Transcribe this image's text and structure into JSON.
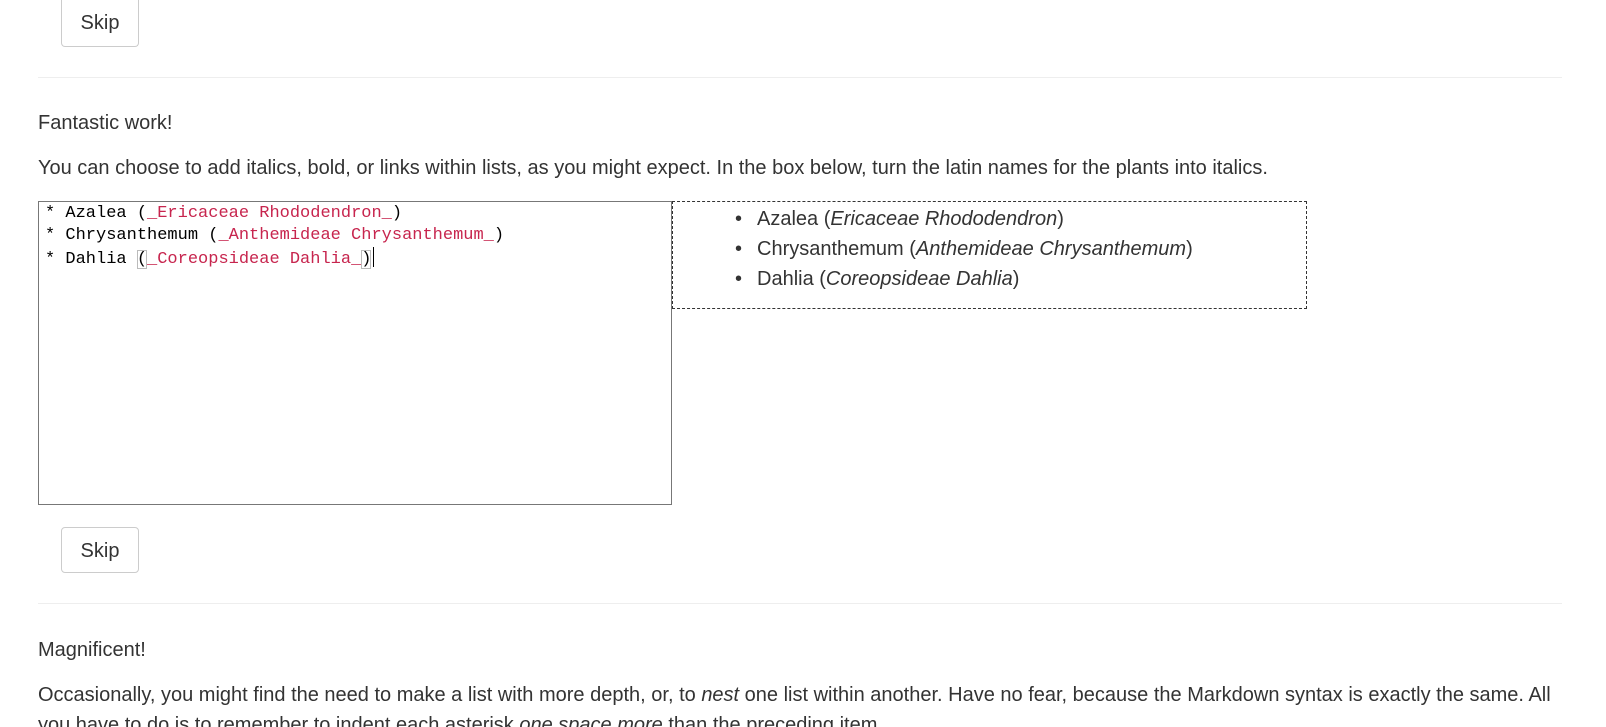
{
  "skip_button_label": "Skip",
  "section_2": {
    "heading": "Fantastic work!",
    "instructions": "You can choose to add italics, bold, or links within lists, as you might expect. In the box below, turn the latin names for the plants into italics.",
    "editor_lines": [
      {
        "prefix": "* Azalea (",
        "emphasis": "_Ericaceae Rhododendron_",
        "suffix": ")"
      },
      {
        "prefix": "* Chrysanthemum (",
        "emphasis": "_Anthemideae Chrysanthemum_",
        "suffix": ")"
      },
      {
        "prefix": "* Dahlia ",
        "open_bracket": "(",
        "emphasis": "_Coreopsideae Dahlia_",
        "suffix": ")"
      }
    ],
    "preview_items": [
      {
        "bullet": "•",
        "name": "Azalea (",
        "latin": "Ericaceae Rhododendron",
        "close": ")"
      },
      {
        "bullet": "•",
        "name": "Chrysanthemum (",
        "latin": "Anthemideae Chrysanthemum",
        "close": ")"
      },
      {
        "bullet": "•",
        "name": "Dahlia (",
        "latin": "Coreopsideae Dahlia",
        "close": ")"
      }
    ]
  },
  "section_3": {
    "heading": "Magnificent!",
    "intro_part1": "Occasionally, you might find the need to make a list with more depth, or, to ",
    "intro_em1": "nest",
    "intro_part2": " one list within another. Have no fear, because the Markdown syntax is exactly the same. All you have to do is to remember to indent each asterisk ",
    "intro_em2": "one space more",
    "intro_part3": " than the preceding item."
  },
  "colors": {
    "text": "#333333",
    "markdown_emphasis": "#c7254e",
    "divider": "#eeeeee",
    "button_border": "#cccccc"
  }
}
